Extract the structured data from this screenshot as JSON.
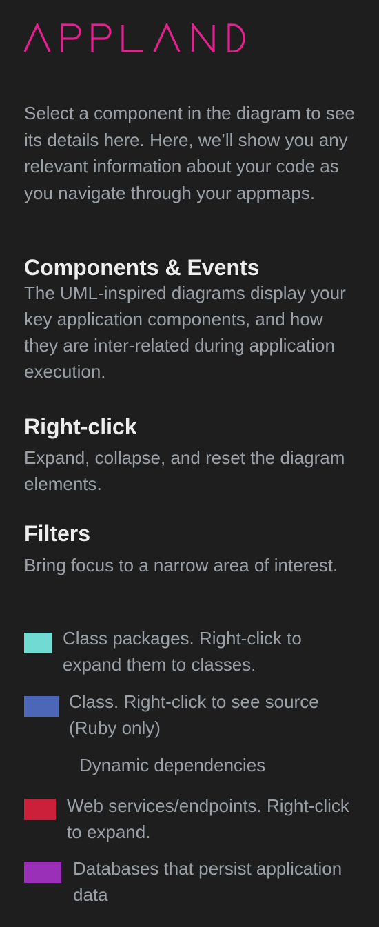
{
  "brand": {
    "logo_text": "APPLAND",
    "color": "#e6208f"
  },
  "intro": "Select a component in the diagram to see its details here. Here, we’ll show you any relevant information about your code as you navigate through your appmaps.",
  "sections": [
    {
      "title": "Components & Events",
      "body": "The UML-inspired diagrams display your key application components, and how they are inter-related during application execution."
    },
    {
      "title": "Right-click",
      "body": "Expand, collapse, and reset the diagram elements."
    },
    {
      "title": "Filters",
      "body": "Bring focus to a narrow area of interest."
    }
  ],
  "legend": [
    {
      "text": "Class packages. Right-click to expand them to classes.",
      "color": "#6fdbd3",
      "icon": "class-package-swatch"
    },
    {
      "text": "Class. Right-click to see source (Ruby only)",
      "color": "#4c66b8",
      "icon": "class-swatch"
    },
    {
      "text": "Dynamic dependencies",
      "color": "",
      "icon": "dynamic-dependency-line"
    },
    {
      "text": "Web services/endpoints. Right-click to expand.",
      "color": "#cc1f3a",
      "icon": "http-swatch"
    },
    {
      "text": "Databases that persist application data",
      "color": "#9b30b8",
      "icon": "database-swatch"
    }
  ],
  "colors": {
    "background": "#1e1e1e",
    "heading": "#ededed",
    "body_text": "#9aa0a6"
  }
}
